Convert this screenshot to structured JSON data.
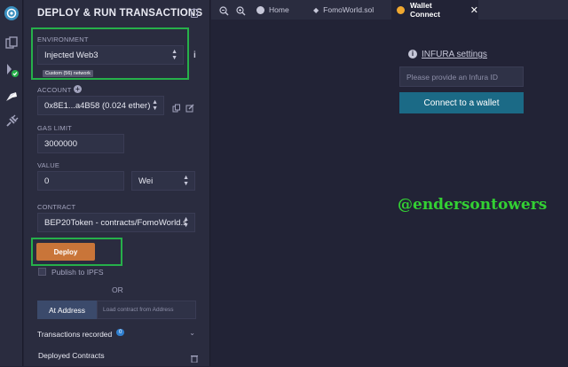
{
  "deploy_panel": {
    "title": "DEPLOY & RUN TRANSACTIONS",
    "environment": {
      "label": "ENVIRONMENT",
      "value": "Injected Web3",
      "network_badge": "Custom (56) network"
    },
    "account": {
      "label": "ACCOUNT",
      "value": "0x8E1...a4B58 (0.024 ether)"
    },
    "gas_limit": {
      "label": "GAS LIMIT",
      "value": "3000000"
    },
    "value": {
      "label": "VALUE",
      "amount": "0",
      "unit": "Wei"
    },
    "contract": {
      "label": "CONTRACT",
      "value": "BEP20Token - contracts/FomoWorld.s"
    },
    "deploy_label": "Deploy",
    "publish_ipfs_label": "Publish to IPFS",
    "or_label": "OR",
    "at_address_label": "At Address",
    "load_contract_placeholder": "Load contract from Address",
    "transactions_recorded_label": "Transactions recorded",
    "transactions_recorded_count": "0",
    "deployed_contracts_label": "Deployed Contracts"
  },
  "tabs": [
    {
      "label": "Home"
    },
    {
      "label": "FomoWorld.sol"
    },
    {
      "label": "Wallet Connect"
    }
  ],
  "wallet_connect": {
    "infura_settings_label": "INFURA settings",
    "infura_placeholder": "Please provide an Infura ID",
    "connect_button_label": "Connect to a wallet"
  },
  "watermark": "@endersontowers",
  "colors": {
    "highlight": "#26b04a",
    "deploy_button": "#c97539",
    "connect_button": "#1b6a86",
    "watermark": "#33d033",
    "badge_count": "#2f7fd0"
  }
}
